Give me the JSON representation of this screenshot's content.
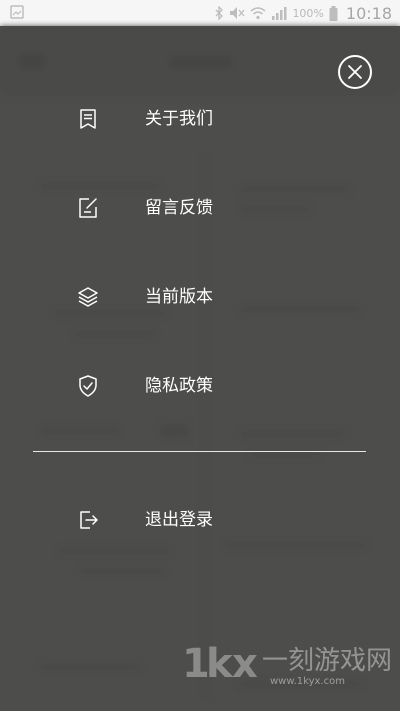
{
  "status_bar": {
    "battery": "100%",
    "time": "10:18"
  },
  "menu": {
    "items": [
      {
        "label": "关于我们",
        "icon": "document-icon"
      },
      {
        "label": "留言反馈",
        "icon": "edit-icon"
      },
      {
        "label": "当前版本",
        "icon": "layers-icon"
      },
      {
        "label": "隐私政策",
        "icon": "shield-check-icon"
      }
    ],
    "logout": {
      "label": "退出登录",
      "icon": "logout-icon"
    },
    "close_icon": "close-icon"
  },
  "watermark": {
    "text": "一刻游戏网",
    "url": "www.1kyx.com"
  },
  "colors": {
    "overlay": "#575755",
    "text": "#ffffff",
    "status_bar_bg": "#f6f6f6"
  }
}
